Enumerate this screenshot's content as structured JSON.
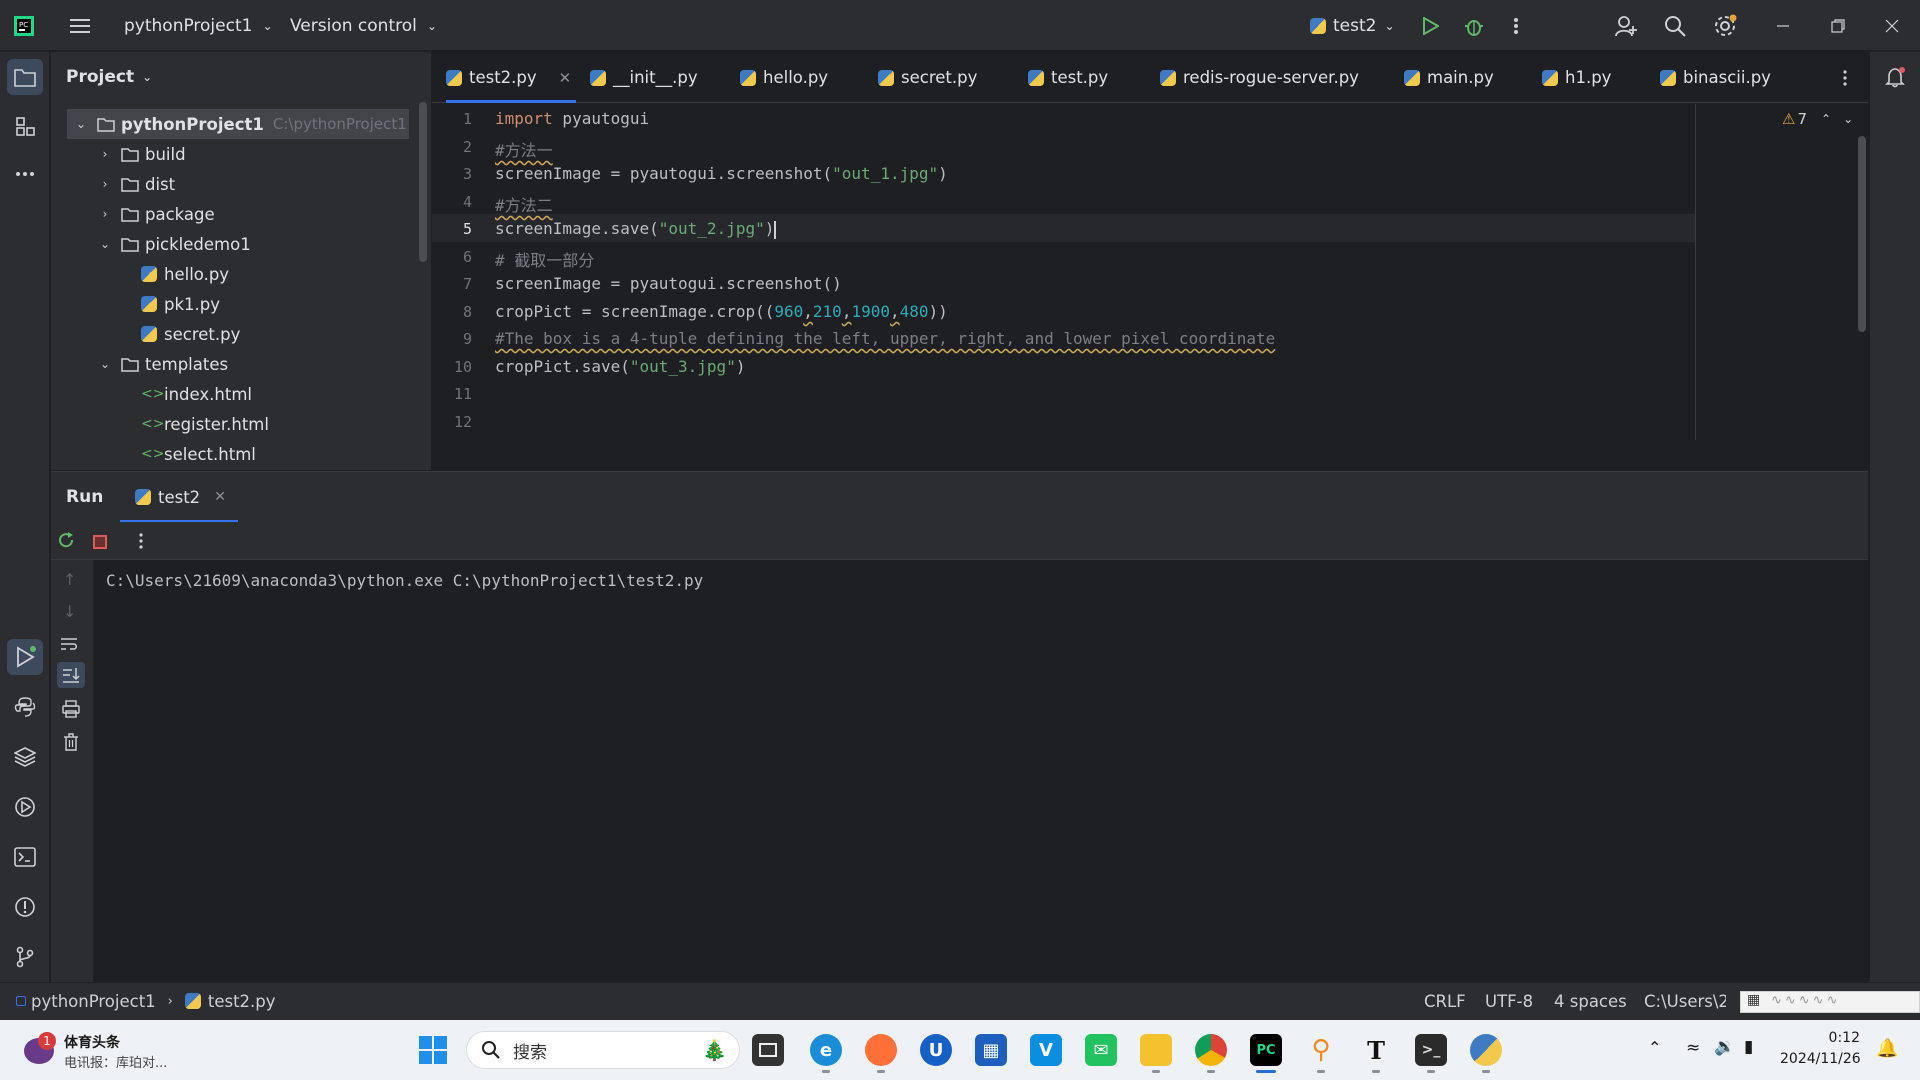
{
  "titlebar": {
    "project_name": "pythonProject1",
    "version_control": "Version control",
    "run_config": "test2"
  },
  "project_panel": {
    "title": "Project",
    "tree": [
      {
        "label": "pythonProject1",
        "path": "C:\\pythonProject1",
        "type": "root"
      },
      {
        "label": "build",
        "type": "folder"
      },
      {
        "label": "dist",
        "type": "folder"
      },
      {
        "label": "package",
        "type": "folder"
      },
      {
        "label": "pickledemo1",
        "type": "folder-open"
      },
      {
        "label": "hello.py",
        "type": "py"
      },
      {
        "label": "pk1.py",
        "type": "py"
      },
      {
        "label": "secret.py",
        "type": "py"
      },
      {
        "label": "templates",
        "type": "folder-open"
      },
      {
        "label": "index.html",
        "type": "html"
      },
      {
        "label": "register.html",
        "type": "html"
      },
      {
        "label": "select.html",
        "type": "html"
      }
    ]
  },
  "editor": {
    "tabs": [
      "test2.py",
      "__init__.py",
      "hello.py",
      "secret.py",
      "test.py",
      "redis-rogue-server.py",
      "main.py",
      "h1.py",
      "binascii.py"
    ],
    "warnings": "7",
    "current_line": "5",
    "line_numbers": [
      "1",
      "2",
      "3",
      "4",
      "5",
      "6",
      "7",
      "8",
      "9",
      "10",
      "11",
      "12"
    ],
    "code": {
      "l1_kw": "import",
      "l1_rest": " pyautogui",
      "l2": "#方法一",
      "l3_a": "screenImage = pyautogui.screenshot(",
      "l3_s": "\"out_1.jpg\"",
      "l3_b": ")",
      "l4": "#方法二",
      "l5_a": "screenImage.save(",
      "l5_s": "\"out_2.jpg\"",
      "l5_b": ")",
      "l6": "# 截取一部分",
      "l7": "screenImage = pyautogui.screenshot()",
      "l8_a": "cropPict = screenImage.crop((",
      "l8_n1": "960",
      "l8_n2": "210",
      "l8_n3": "1900",
      "l8_n4": "480",
      "l8_b": "))",
      "l8_comma": ",",
      "l9": "#The box is a 4-tuple defining the left, upper, right, and lower pixel coordinate",
      "l10_a": "cropPict.save(",
      "l10_s": "\"out_3.jpg\"",
      "l10_b": ")"
    }
  },
  "run_panel": {
    "title": "Run",
    "tab": "test2",
    "output": "C:\\Users\\21609\\anaconda3\\python.exe C:\\pythonProject1\\test2.py"
  },
  "statusbar": {
    "breadcrumb_project": "pythonProject1",
    "breadcrumb_file": "test2.py",
    "line_sep": "CRLF",
    "encoding": "UTF-8",
    "indent": "4 spaces",
    "path": "C:\\Users\\2"
  },
  "taskbar": {
    "news_badge": "1",
    "news_title": "体育头条",
    "news_sub": "电讯报：库珀对...",
    "search_placeholder": "搜索",
    "time": "0:12",
    "date": "2024/11/26"
  }
}
